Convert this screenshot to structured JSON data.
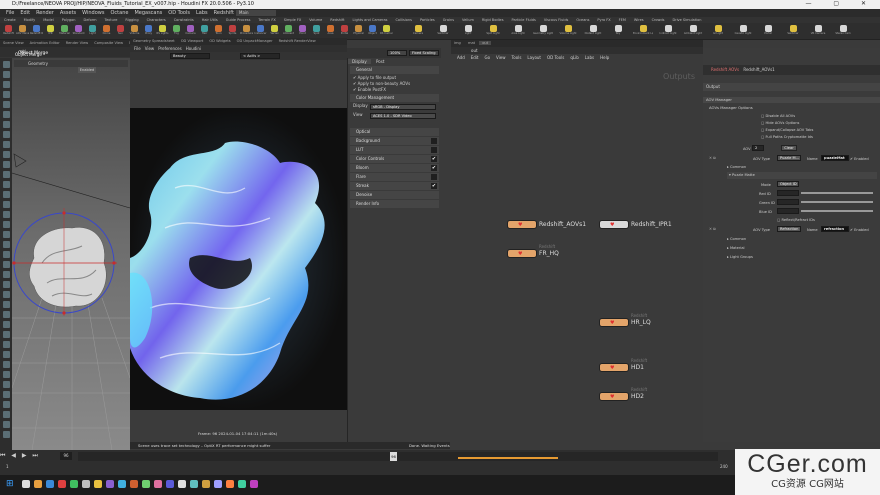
{
  "window": {
    "title": "D:/Freelance/NEOVA PROJ/HIP/NEOVA_Fluids_Tutorial_EX_v007.hip - Houdini FX 20.0.506 - Py3.10",
    "controls": "—  ▢  ✕"
  },
  "menu": [
    "File",
    "Edit",
    "Render",
    "Assets",
    "Windows",
    "Octane",
    "Megascans",
    "OD Tools",
    "Labs",
    "Redshift",
    "qLib",
    "Help"
  ],
  "desktop": "Main",
  "shelf_tabs": [
    "Create",
    "Modify",
    "Model",
    "Polygon",
    "Deform",
    "Texture",
    "Rigging",
    "Characters",
    "Constraints",
    "Hair Utils",
    "Guide Process",
    "Terrain FX",
    "Simple FX",
    "Volume",
    "Redshift",
    "Lights and Cameras",
    "Collisions",
    "Particles",
    "Grains",
    "Vellum",
    "Rigid Bodies",
    "Particle Fluids",
    "Viscous Fluids",
    "Oceans",
    "Pyro FX",
    "FEM",
    "Wires",
    "Crowds",
    "Drive Simulation"
  ],
  "shelf_tools_left": [
    "Redshift",
    "AOV Manager",
    "Redshift ROP",
    "IPR",
    "Material",
    "Standard",
    "Light",
    "Dome",
    "Sun",
    "Volume",
    "Proxy",
    "RS Lights",
    "Fog",
    "Camera",
    "Hair",
    "Toon",
    "Sprite",
    "Procedural",
    "Instancer",
    "Vertex",
    "Ambient",
    "Point",
    "Spot",
    "Area",
    "Portal",
    "Physical",
    "Object",
    "RS Camera"
  ],
  "shelf_tools_right": [
    "Camera",
    "Switcher",
    "Light",
    "Spot Light",
    "Area Light",
    "Geometry Light",
    "Volume Light",
    "Distant Light",
    "Sky",
    "Environment Light",
    "Indirect Light",
    "Ambient Light",
    "GI Light",
    "Caustic Light",
    "Portal",
    "Switcher",
    "VR Camera",
    "Stereo Cam"
  ],
  "left_panel": {
    "tabs": [
      "Scene View",
      "Animation Editor",
      "Render View",
      "Composite View",
      "Motion FX View",
      "Geometry Spreadsheet"
    ],
    "path": "obj",
    "node": "Object Merge",
    "enabled": "Enabled",
    "node2": "Geometry"
  },
  "render_view": {
    "tabs": [
      "Geometry Spreadsheet",
      "OD Viewport",
      "OD Widgets",
      "OD UnpackManager",
      "Redshift RenderView"
    ],
    "menu": [
      "File",
      "View",
      "Preferences",
      "Houdini"
    ],
    "beauty": "Beauty",
    "aovs": "< AoVs >",
    "zoom": "100%",
    "scaling": "Fixed Scaling",
    "frame_info": "Frame: 96   2024-01-04 17:04:11  (1m:40s)",
    "status": "Scene uses trace set technology – OptiX RT performance might suffer"
  },
  "render_settings": {
    "tabs": [
      "Display",
      "Post"
    ],
    "general_header": "General",
    "checks": [
      "Apply to file output",
      "Apply to non-beauty AOVs",
      "Enable PostFX"
    ],
    "color_mgmt": "Color Management",
    "display_label": "Display",
    "display_value": "sRGB - Display",
    "view_label": "View",
    "view_value": "ACES 1.0 - SDR Video",
    "sections": [
      "Optical",
      "Background",
      "LUT",
      "Color Controls",
      "Bloom",
      "Flare",
      "Streak",
      "Denoise",
      "Render Info"
    ]
  },
  "network": {
    "tabs": [
      "img",
      "mat",
      "out"
    ],
    "path": "out",
    "menu": [
      "Add",
      "Edit",
      "Go",
      "View",
      "Tools",
      "Layout",
      "OD Tools",
      "qLib",
      "Labs",
      "Help"
    ],
    "context_label": "Outputs",
    "nodes": [
      {
        "name": "Redshift_AOVs1",
        "sub": ""
      },
      {
        "name": "Redshift_IPR1",
        "sub": ""
      },
      {
        "name": "FR_HQ",
        "sub": "Redshift"
      },
      {
        "name": "HR_LQ",
        "sub": "Redshift"
      },
      {
        "name": "HD1",
        "sub": "Redshift"
      },
      {
        "name": "HD2",
        "sub": "Redshift"
      }
    ]
  },
  "params": {
    "node_type": "Redshift AOVs",
    "node_name": "Redshift_AOVs1",
    "tab": "Output",
    "section": "AOV Manager",
    "subsection": "AOVs Manager Options",
    "options": [
      "Disable All AOVs",
      "Hide AOVs Options",
      "Expand/Collapse AOV Tabs",
      "Full Paths Cryptomatte Ids"
    ],
    "aov_label": "AOV",
    "aov_count": "2",
    "clear": "Clear",
    "aov1": {
      "type_label": "AOV Type",
      "type": "Puzzle M...",
      "name_label": "Name",
      "name": "puzzleMat",
      "enabled": "Enabled",
      "common": "Common",
      "puzzle": "Puzzle Matte",
      "mode_label": "Mode",
      "mode": "Object ID",
      "red": "Red ID",
      "green": "Green ID",
      "blue": "Blue ID",
      "refl": "Reflect/Refract IDs"
    },
    "aov2": {
      "type_label": "AOV Type",
      "type": "Refraction",
      "name_label": "Name",
      "name": "refraction",
      "enabled": "Enabled",
      "common": "Common",
      "material": "Material",
      "groups": "Light Groups"
    }
  },
  "timeline": {
    "frame": "96",
    "start": "1",
    "end": "240",
    "status": "Done. Waiting Events"
  },
  "watermark": {
    "line1": "CGer.com",
    "line2": "CG资源 CG网站"
  },
  "colors": {
    "node_orange": "#e3a46a",
    "node_gray": "#d8d8d8",
    "heart": "#e03030"
  }
}
